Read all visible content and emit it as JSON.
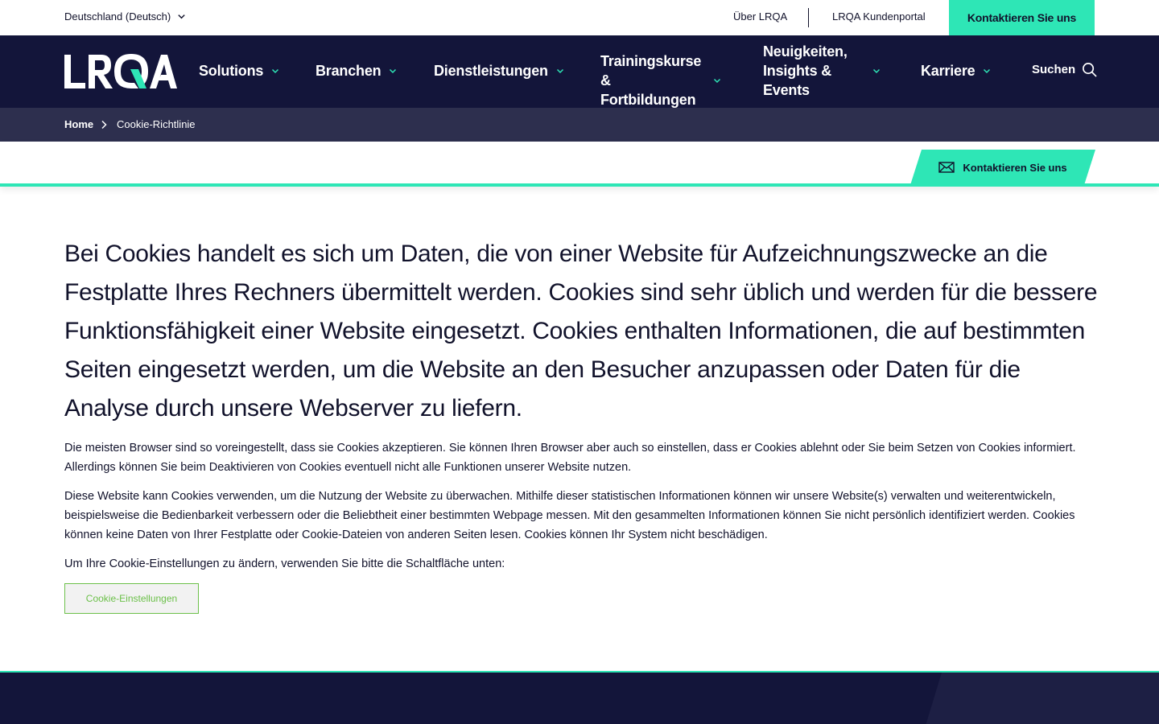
{
  "topbar": {
    "language": "Deutschland (Deutsch)",
    "about": "Über LRQA",
    "portal": "LRQA Kundenportal",
    "contact": "Kontaktieren Sie uns"
  },
  "nav": {
    "logo_text": "LRQA",
    "items": [
      {
        "label": "Solutions"
      },
      {
        "label": "Branchen"
      },
      {
        "label": "Dienstleistungen"
      },
      {
        "label": "Trainingskurse & Fortbildungen"
      },
      {
        "label": "Neuigkeiten, Insights & Events"
      },
      {
        "label": "Karriere"
      }
    ],
    "search_label": "Suchen"
  },
  "breadcrumb": {
    "home": "Home",
    "current": "Cookie-Richtlinie"
  },
  "strip": {
    "contact_label": "Kontaktieren Sie uns"
  },
  "content": {
    "lead": "Bei Cookies handelt es sich um Daten, die von einer Website für Aufzeichnungszwecke an die Festplatte Ihres Rechners übermittelt werden. Cookies sind sehr üblich und werden für die bessere Funktionsfähigkeit einer Website eingesetzt. Cookies enthalten Informationen, die auf bestimmten Seiten eingesetzt werden, um die Website an den Besucher anzupassen oder Daten für die Analyse durch unsere Webserver zu liefern.",
    "p1": "Die meisten Browser sind so voreingestellt, dass sie Cookies akzeptieren. Sie können Ihren Browser aber auch so einstellen, dass er Cookies ablehnt oder Sie beim Setzen von Cookies informiert. Allerdings können Sie beim Deaktivieren von Cookies eventuell nicht alle Funktionen unserer Website nutzen.",
    "p2": "Diese Website kann Cookies verwenden, um die Nutzung der Website zu überwachen. Mithilfe dieser statistischen Informationen können wir unsere Website(s) verwalten und weiterentwickeln, beispielsweise die Bedienbarkeit verbessern oder die Beliebtheit einer bestimmten Webpage messen. Mit den gesammelten Informationen können Sie nicht persönlich identifiziert werden. Cookies können keine Daten von Ihrer Festplatte oder Cookie-Dateien von anderen Seiten lesen. Cookies können Ihr System nicht beschädigen.",
    "p3": "Um Ihre Cookie-Einstellungen zu ändern, verwenden Sie bitte die Schaltfläche unten:",
    "cookie_button": "Cookie-Einstellungen"
  },
  "colors": {
    "navy": "#13153a",
    "accent": "#2ee6b6",
    "breadcrumb_bg": "#2d2f4e",
    "cookie_button_text": "#6cc04a"
  },
  "icons": [
    "chevron-down-icon",
    "search-icon",
    "chevron-right-icon",
    "mail-icon"
  ]
}
